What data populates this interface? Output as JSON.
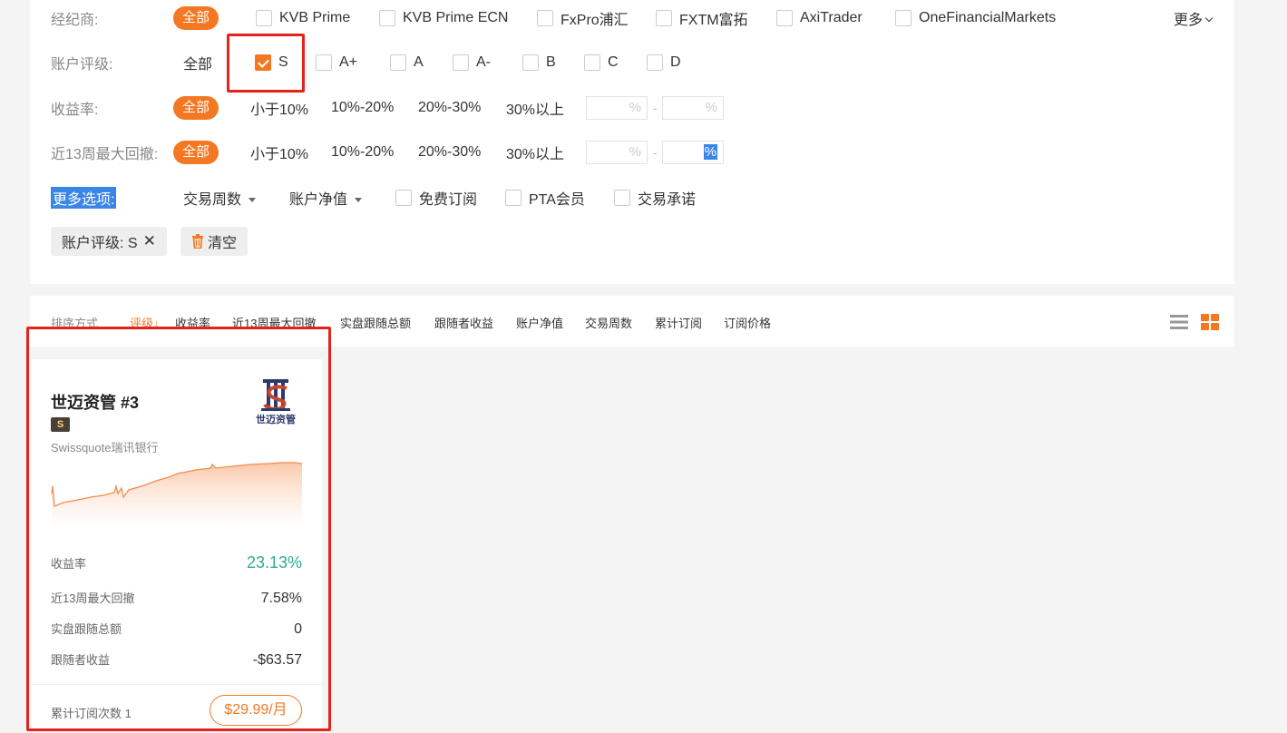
{
  "filters": {
    "broker": {
      "label": "经纪商:",
      "all": "全部",
      "options": [
        "KVB Prime",
        "KVB Prime ECN",
        "FxPro浦汇",
        "FXTM富拓",
        "AxiTrader",
        "OneFinancialMarkets"
      ],
      "more": "更多"
    },
    "rating": {
      "label": "账户评级:",
      "all": "全部",
      "options": [
        {
          "label": "S",
          "checked": true
        },
        {
          "label": "A+",
          "checked": false
        },
        {
          "label": "A",
          "checked": false
        },
        {
          "label": "A-",
          "checked": false
        },
        {
          "label": "B",
          "checked": false
        },
        {
          "label": "C",
          "checked": false
        },
        {
          "label": "D",
          "checked": false
        }
      ]
    },
    "return_rate": {
      "label": "收益率:",
      "all": "全部",
      "options": [
        "小于10%",
        "10%-20%",
        "20%-30%",
        "30%以上"
      ],
      "min_unit": "%",
      "max_unit": "%",
      "separator": "-"
    },
    "drawdown": {
      "label": "近13周最大回撤:",
      "all": "全部",
      "options": [
        "小于10%",
        "10%-20%",
        "20%-30%",
        "30%以上"
      ],
      "min_unit": "%",
      "max_unit": "%",
      "separator": "-"
    },
    "more_options": {
      "label": "更多选项:",
      "dropdowns": [
        "交易周数",
        "账户净值"
      ],
      "checkboxes": [
        "免费订阅",
        "PTA会员",
        "交易承诺"
      ]
    },
    "active": {
      "tag_label": "账户评级: S",
      "clear_label": "清空"
    }
  },
  "sort": {
    "label": "排序方式",
    "items": [
      {
        "label": "评级",
        "active": true
      },
      {
        "label": "收益率",
        "active": false
      },
      {
        "label": "近13周最大回撤",
        "active": false
      },
      {
        "label": "实盘跟随总额",
        "active": false
      },
      {
        "label": "跟随者收益",
        "active": false
      },
      {
        "label": "账户净值",
        "active": false
      },
      {
        "label": "交易周数",
        "active": false
      },
      {
        "label": "累计订阅",
        "active": false
      },
      {
        "label": "订阅价格",
        "active": false
      }
    ]
  },
  "card": {
    "title": "世迈资管 #3",
    "badge": "S",
    "broker": "Swissquote瑞讯银行",
    "logo_text": "世迈资管",
    "stats": [
      {
        "key": "收益率",
        "value": "23.13%"
      },
      {
        "key": "近13周最大回撤",
        "value": "7.58%"
      },
      {
        "key": "实盘跟随总额",
        "value": "0"
      },
      {
        "key": "跟随者收益",
        "value": "-$63.57"
      }
    ],
    "subs_label": "累计订阅次数",
    "subs_count": "1",
    "price": "$29.99/月"
  },
  "colors": {
    "accent": "#f47721",
    "positive": "#2fae8c",
    "highlight": "#e5231d"
  }
}
